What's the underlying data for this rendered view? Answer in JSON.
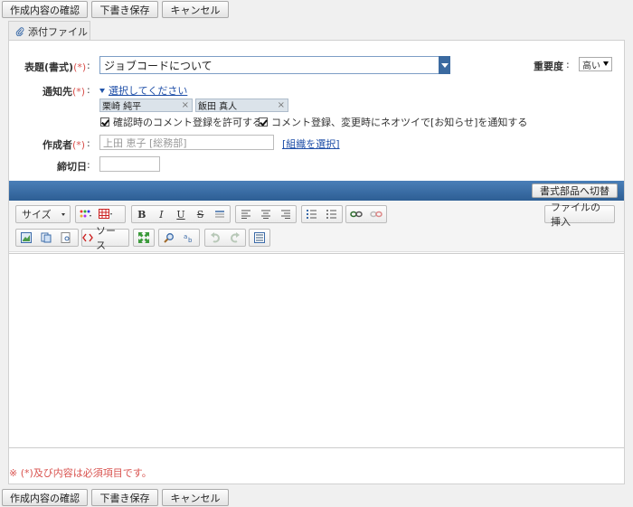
{
  "actions": {
    "confirm_label": "作成内容の確認",
    "draft_label": "下書き保存",
    "cancel_label": "キャンセル"
  },
  "attach_tab": {
    "label": "添付ファイル"
  },
  "form": {
    "subject": {
      "label": "表題(書式)",
      "required": "(*)",
      "colon": ":",
      "value": "ジョブコードについて"
    },
    "priority": {
      "label": "重要度",
      "colon": ":",
      "value": "高い"
    },
    "recipients": {
      "label": "通知先",
      "required": "(*)",
      "colon": ":",
      "select_link": "選択してください",
      "chips": [
        {
          "name": "栗崎 純平",
          "remove": "×"
        },
        {
          "name": "飯田 真人",
          "remove": "×"
        }
      ]
    },
    "checkboxes": [
      {
        "label": "確認時のコメント登録を許可する",
        "checked": true
      },
      {
        "label": "コメント登録、変更時にネオツイで[お知らせ]を通知する",
        "checked": true
      }
    ],
    "author": {
      "label": "作成者",
      "required": "(*)",
      "colon": ":",
      "value": "上田 恵子 [総務部]",
      "org_link": "[組織を選択]"
    },
    "deadline": {
      "label": "締切日",
      "colon": ":",
      "value": ""
    }
  },
  "editor": {
    "switch_label": "書式部品へ切替",
    "size_label": "サイズ",
    "source_label": "ソース",
    "insert_file_label": "ファイルの挿入",
    "bold": "B",
    "italic": "I",
    "underline": "U",
    "strike": "S"
  },
  "footnote": "※ (*)及び内容は必須項目です。",
  "colors": {
    "accent": "#2d5e94",
    "required": "#d9534f",
    "link": "#1f4fa8"
  }
}
